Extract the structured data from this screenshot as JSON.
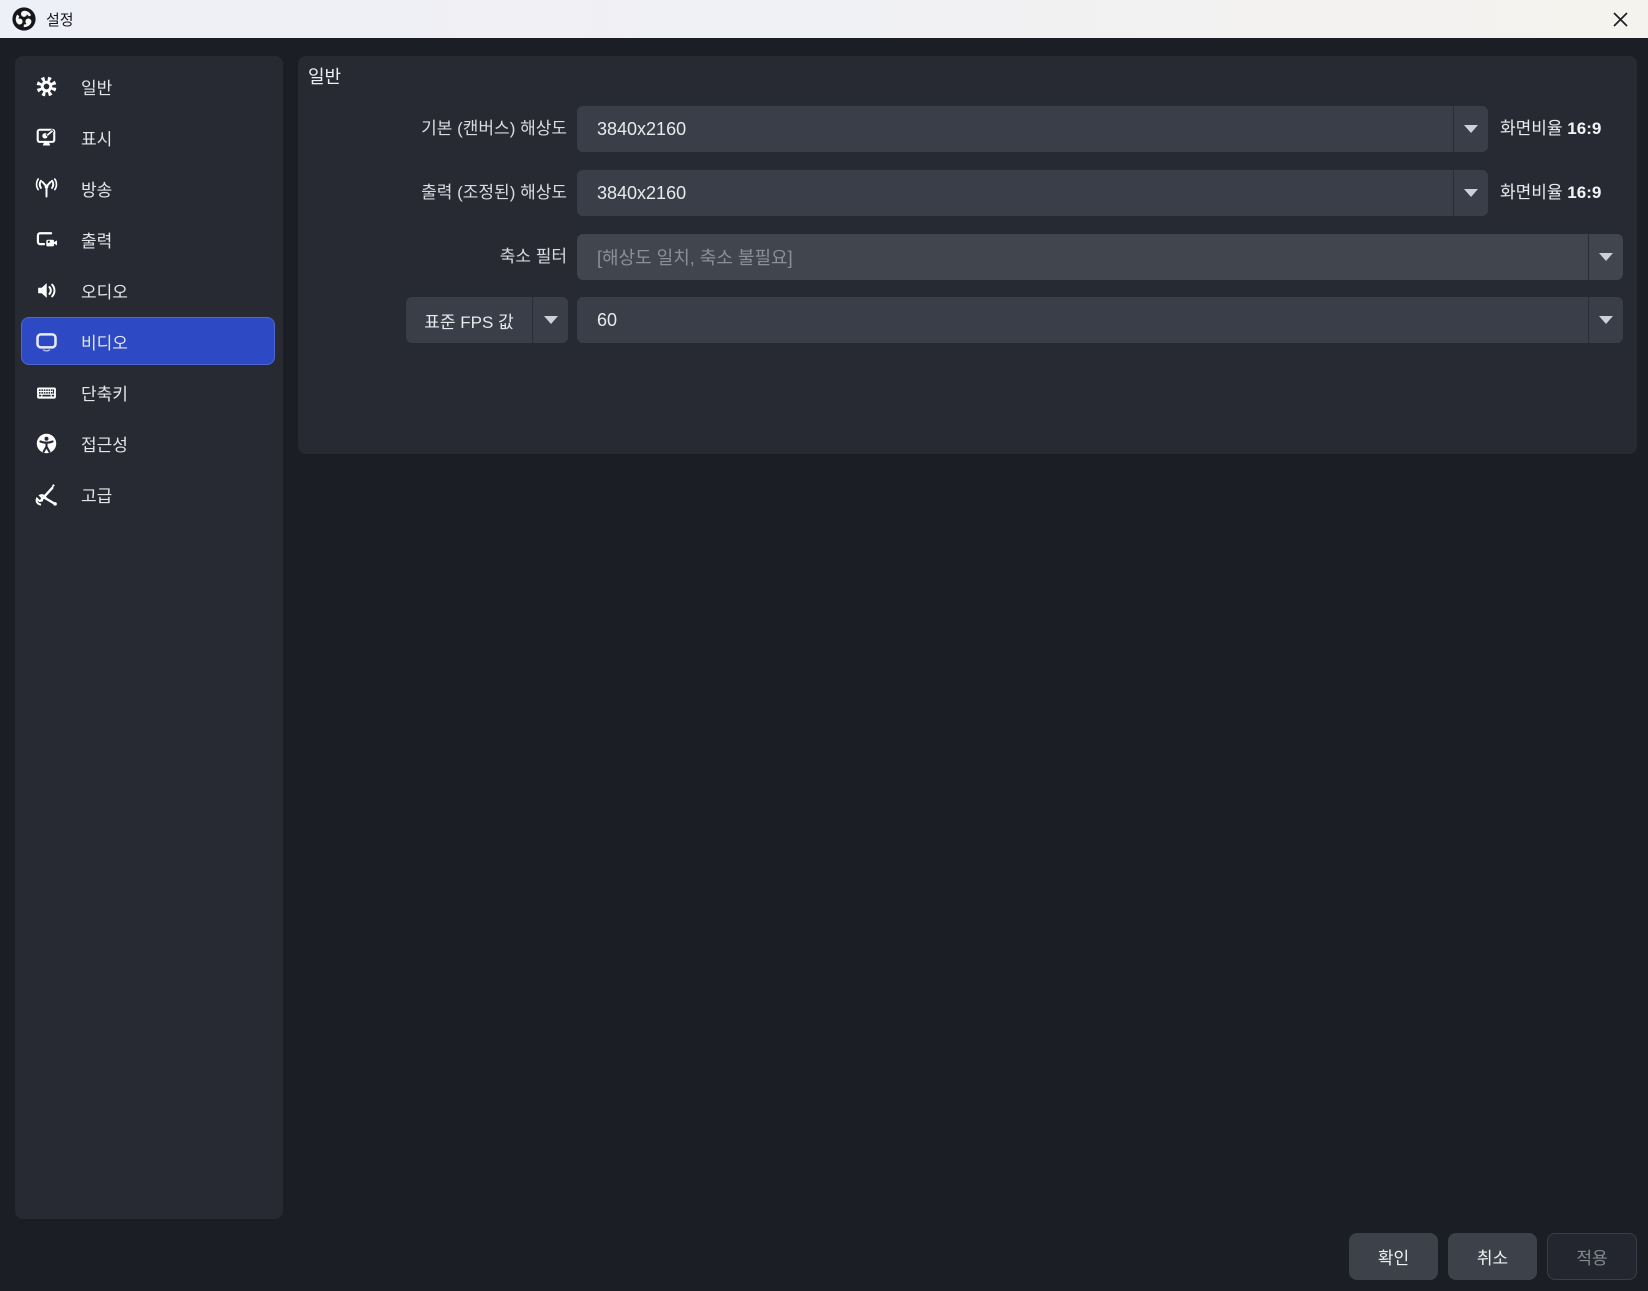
{
  "window": {
    "title": "설정"
  },
  "sidebar": {
    "items": [
      {
        "label": "일반",
        "icon": "gear-icon"
      },
      {
        "label": "표시",
        "icon": "appearance-icon"
      },
      {
        "label": "방송",
        "icon": "broadcast-icon"
      },
      {
        "label": "출력",
        "icon": "output-icon"
      },
      {
        "label": "오디오",
        "icon": "audio-icon"
      },
      {
        "label": "비디오",
        "icon": "video-icon"
      },
      {
        "label": "단축키",
        "icon": "hotkeys-icon"
      },
      {
        "label": "접근성",
        "icon": "accessibility-icon"
      },
      {
        "label": "고급",
        "icon": "advanced-icon"
      }
    ],
    "selected_label": "비디오"
  },
  "panel": {
    "header": "일반",
    "base_resolution": {
      "label": "기본 (캔버스) 해상도",
      "value": "3840x2160",
      "aspect_label": "화면비율",
      "aspect_value": "16:9"
    },
    "output_resolution": {
      "label": "출력 (조정된) 해상도",
      "value": "3840x2160",
      "aspect_label": "화면비율",
      "aspect_value": "16:9"
    },
    "downscale_filter": {
      "label": "축소 필터",
      "placeholder": "[해상도 일치, 축소 불필요]"
    },
    "fps": {
      "type_label": "표준 FPS 값",
      "value": "60"
    }
  },
  "footer": {
    "ok": "확인",
    "cancel": "취소",
    "apply": "적용"
  },
  "colors": {
    "accent_blue": "#2e49c4",
    "accent_blue_border": "#4e67d2",
    "titlebar_bg": "#f1f2f5",
    "dialog_bg": "#1c1e25",
    "panel_bg": "#272a33",
    "control_bg": "#3a3e48",
    "disabled_control_bg": "#41454e"
  }
}
